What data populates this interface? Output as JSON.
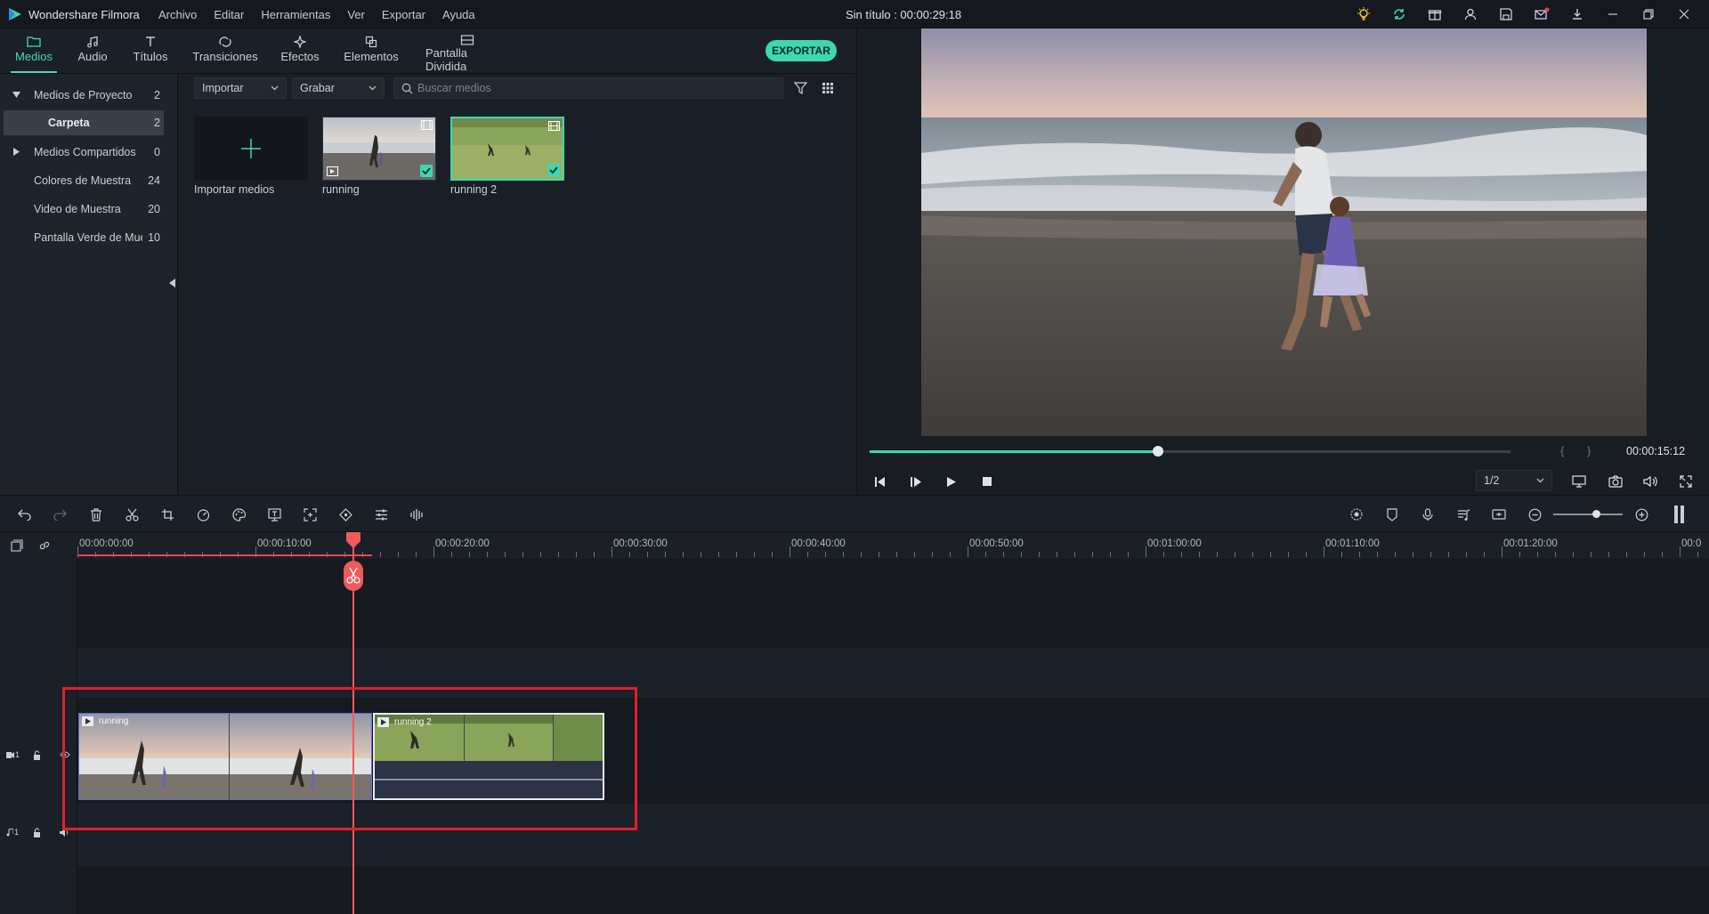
{
  "app": {
    "name": "Wondershare Filmora",
    "document_title": "Sin título : 00:00:29:18",
    "menus": [
      "Archivo",
      "Editar",
      "Herramientas",
      "Ver",
      "Exportar",
      "Ayuda"
    ],
    "titlebar_icons": [
      "lightbulb-icon",
      "sync-icon",
      "gift-icon",
      "account-icon",
      "save-icon",
      "mail-icon",
      "download-icon",
      "minimize-icon",
      "restore-icon",
      "close-icon"
    ]
  },
  "tabs": [
    {
      "label": "Medios",
      "icon": "folder-icon",
      "active": true
    },
    {
      "label": "Audio",
      "icon": "music-note-icon",
      "active": false
    },
    {
      "label": "Títulos",
      "icon": "text-t-icon",
      "active": false
    },
    {
      "label": "Transiciones",
      "icon": "transition-icon",
      "active": false
    },
    {
      "label": "Efectos",
      "icon": "sparkle-icon",
      "active": false
    },
    {
      "label": "Elementos",
      "icon": "elements-icon",
      "active": false
    },
    {
      "label": "Pantalla Dividida",
      "icon": "split-screen-icon",
      "active": false
    }
  ],
  "export_label": "EXPORTAR",
  "sidebar": {
    "items": [
      {
        "label": "Medios de Proyecto",
        "count": "2",
        "expanded": true
      },
      {
        "label": "Carpeta",
        "count": "2",
        "active": true
      },
      {
        "label": "Medios Compartidos",
        "count": "0",
        "expanded": false
      },
      {
        "label": "Colores de Muestra",
        "count": "24"
      },
      {
        "label": "Video de Muestra",
        "count": "20"
      },
      {
        "label": "Pantalla Verde de Mue",
        "count": "10"
      }
    ]
  },
  "media": {
    "import_dropdown": "Importar",
    "record_dropdown": "Grabar",
    "search_placeholder": "Buscar medios",
    "import_tile_label": "Importar medios",
    "items": [
      {
        "name": "running",
        "checked": true,
        "selected": false
      },
      {
        "name": "running 2",
        "checked": true,
        "selected": true
      }
    ]
  },
  "preview": {
    "time": "00:00:15:12",
    "progress": 0.45,
    "ratio": "1/2",
    "bracket_in": "{",
    "bracket_out": "}"
  },
  "timeline": {
    "ruler": [
      "00:00:00:00",
      "00:00:10:00",
      "00:00:20:00",
      "00:00:30:00",
      "00:00:40:00",
      "00:00:50:00",
      "00:01:00:00",
      "00:01:10:00",
      "00:01:20:00",
      "00:0"
    ],
    "tracks": [
      {
        "label": "1",
        "type": "video"
      },
      {
        "label": "1",
        "type": "audio"
      }
    ],
    "clips": [
      {
        "name": "running",
        "track": "video"
      },
      {
        "name": "running 2",
        "track": "video",
        "selected": true
      }
    ]
  }
}
